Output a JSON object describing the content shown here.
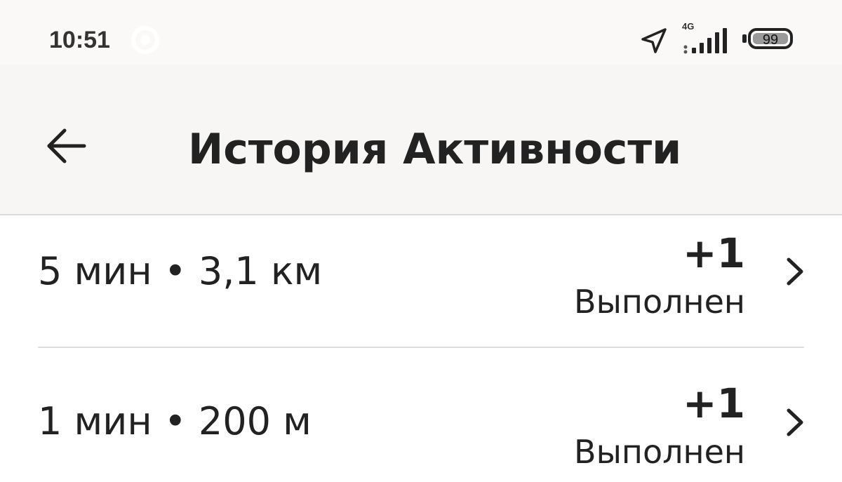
{
  "status_bar": {
    "time": "10:51",
    "network": "4G",
    "battery_percent": "99",
    "battery_level": 0.99
  },
  "header": {
    "title": "История Активности",
    "back_icon": "arrow-left-icon"
  },
  "activities": [
    {
      "duration": "5 мин",
      "distance": "3,1 км",
      "points": "+1",
      "status": "Выполнен"
    },
    {
      "duration": "1 мин",
      "distance": "200 м",
      "points": "+1",
      "status": "Выполнен"
    }
  ],
  "colors": {
    "header_bg": "#f7f6f4",
    "status_bg": "#faf9f7",
    "text": "#222222",
    "divider": "#dedede"
  }
}
